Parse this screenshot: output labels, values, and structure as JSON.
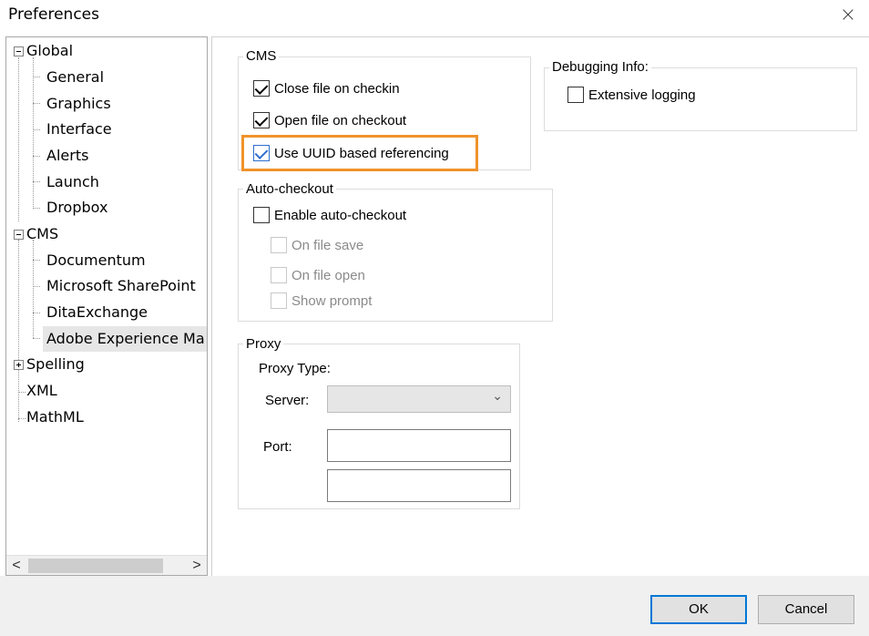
{
  "window": {
    "title": "Preferences",
    "close_glyph": "×"
  },
  "tree": {
    "items": [
      {
        "label": "Global"
      },
      {
        "label": "General"
      },
      {
        "label": "Graphics"
      },
      {
        "label": "Interface"
      },
      {
        "label": "Alerts"
      },
      {
        "label": "Launch"
      },
      {
        "label": "Dropbox"
      },
      {
        "label": "CMS"
      },
      {
        "label": "Documentum"
      },
      {
        "label": "Microsoft SharePoint"
      },
      {
        "label": "DitaExchange"
      },
      {
        "label": "Adobe Experience Ma"
      },
      {
        "label": "Spelling"
      },
      {
        "label": "XML"
      },
      {
        "label": "MathML"
      }
    ],
    "scroll_left": "<",
    "scroll_right": ">"
  },
  "cms_group": {
    "title": "CMS",
    "close_on_checkin": {
      "label": "Close file on checkin",
      "checked": true
    },
    "open_on_checkout": {
      "label": "Open file on checkout",
      "checked": true
    },
    "uuid_referencing": {
      "label": "Use UUID based referencing",
      "checked": true
    }
  },
  "debug_group": {
    "title": "Debugging Info:",
    "extensive_logging": {
      "label": "Extensive logging",
      "checked": false
    }
  },
  "autocheckout_group": {
    "title": "Auto-checkout",
    "enable": {
      "label": "Enable auto-checkout",
      "checked": false
    },
    "on_save": {
      "label": "On file save"
    },
    "on_open": {
      "label": "On file open"
    },
    "show_prompt": {
      "label": "Show prompt"
    }
  },
  "proxy_group": {
    "title": "Proxy",
    "type_label": "Proxy Type:",
    "server_label": "Server:",
    "server_value": "",
    "port_label": "Port:",
    "port_value": "",
    "extra_value": ""
  },
  "buttons": {
    "ok": "OK",
    "cancel": "Cancel"
  },
  "colors": {
    "highlight": "#f0932b",
    "accent": "#0078d7",
    "check_blue": "#2f6fcf"
  }
}
